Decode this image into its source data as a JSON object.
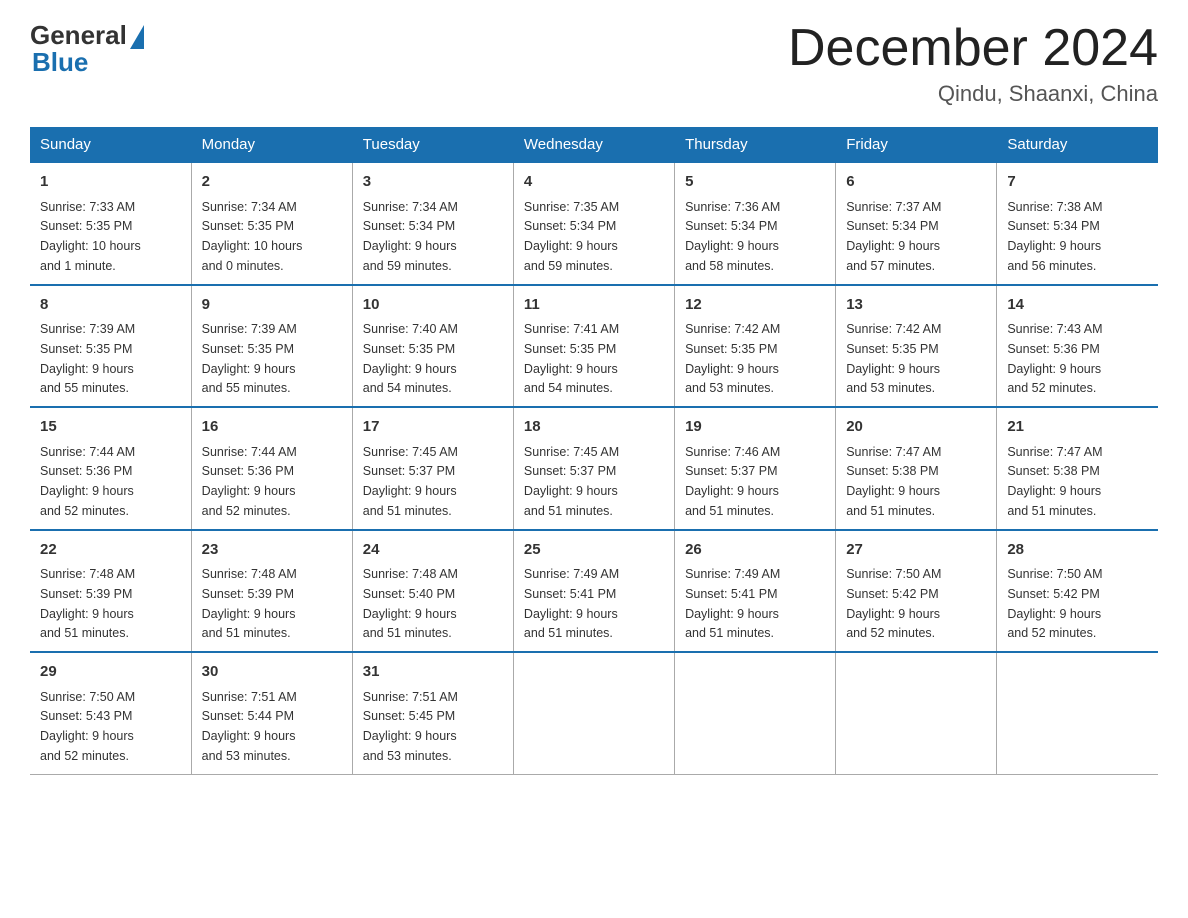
{
  "logo": {
    "general": "General",
    "blue": "Blue"
  },
  "header": {
    "month_year": "December 2024",
    "location": "Qindu, Shaanxi, China"
  },
  "days_of_week": [
    "Sunday",
    "Monday",
    "Tuesday",
    "Wednesday",
    "Thursday",
    "Friday",
    "Saturday"
  ],
  "weeks": [
    [
      {
        "day": "1",
        "info": "Sunrise: 7:33 AM\nSunset: 5:35 PM\nDaylight: 10 hours\nand 1 minute."
      },
      {
        "day": "2",
        "info": "Sunrise: 7:34 AM\nSunset: 5:35 PM\nDaylight: 10 hours\nand 0 minutes."
      },
      {
        "day": "3",
        "info": "Sunrise: 7:34 AM\nSunset: 5:34 PM\nDaylight: 9 hours\nand 59 minutes."
      },
      {
        "day": "4",
        "info": "Sunrise: 7:35 AM\nSunset: 5:34 PM\nDaylight: 9 hours\nand 59 minutes."
      },
      {
        "day": "5",
        "info": "Sunrise: 7:36 AM\nSunset: 5:34 PM\nDaylight: 9 hours\nand 58 minutes."
      },
      {
        "day": "6",
        "info": "Sunrise: 7:37 AM\nSunset: 5:34 PM\nDaylight: 9 hours\nand 57 minutes."
      },
      {
        "day": "7",
        "info": "Sunrise: 7:38 AM\nSunset: 5:34 PM\nDaylight: 9 hours\nand 56 minutes."
      }
    ],
    [
      {
        "day": "8",
        "info": "Sunrise: 7:39 AM\nSunset: 5:35 PM\nDaylight: 9 hours\nand 55 minutes."
      },
      {
        "day": "9",
        "info": "Sunrise: 7:39 AM\nSunset: 5:35 PM\nDaylight: 9 hours\nand 55 minutes."
      },
      {
        "day": "10",
        "info": "Sunrise: 7:40 AM\nSunset: 5:35 PM\nDaylight: 9 hours\nand 54 minutes."
      },
      {
        "day": "11",
        "info": "Sunrise: 7:41 AM\nSunset: 5:35 PM\nDaylight: 9 hours\nand 54 minutes."
      },
      {
        "day": "12",
        "info": "Sunrise: 7:42 AM\nSunset: 5:35 PM\nDaylight: 9 hours\nand 53 minutes."
      },
      {
        "day": "13",
        "info": "Sunrise: 7:42 AM\nSunset: 5:35 PM\nDaylight: 9 hours\nand 53 minutes."
      },
      {
        "day": "14",
        "info": "Sunrise: 7:43 AM\nSunset: 5:36 PM\nDaylight: 9 hours\nand 52 minutes."
      }
    ],
    [
      {
        "day": "15",
        "info": "Sunrise: 7:44 AM\nSunset: 5:36 PM\nDaylight: 9 hours\nand 52 minutes."
      },
      {
        "day": "16",
        "info": "Sunrise: 7:44 AM\nSunset: 5:36 PM\nDaylight: 9 hours\nand 52 minutes."
      },
      {
        "day": "17",
        "info": "Sunrise: 7:45 AM\nSunset: 5:37 PM\nDaylight: 9 hours\nand 51 minutes."
      },
      {
        "day": "18",
        "info": "Sunrise: 7:45 AM\nSunset: 5:37 PM\nDaylight: 9 hours\nand 51 minutes."
      },
      {
        "day": "19",
        "info": "Sunrise: 7:46 AM\nSunset: 5:37 PM\nDaylight: 9 hours\nand 51 minutes."
      },
      {
        "day": "20",
        "info": "Sunrise: 7:47 AM\nSunset: 5:38 PM\nDaylight: 9 hours\nand 51 minutes."
      },
      {
        "day": "21",
        "info": "Sunrise: 7:47 AM\nSunset: 5:38 PM\nDaylight: 9 hours\nand 51 minutes."
      }
    ],
    [
      {
        "day": "22",
        "info": "Sunrise: 7:48 AM\nSunset: 5:39 PM\nDaylight: 9 hours\nand 51 minutes."
      },
      {
        "day": "23",
        "info": "Sunrise: 7:48 AM\nSunset: 5:39 PM\nDaylight: 9 hours\nand 51 minutes."
      },
      {
        "day": "24",
        "info": "Sunrise: 7:48 AM\nSunset: 5:40 PM\nDaylight: 9 hours\nand 51 minutes."
      },
      {
        "day": "25",
        "info": "Sunrise: 7:49 AM\nSunset: 5:41 PM\nDaylight: 9 hours\nand 51 minutes."
      },
      {
        "day": "26",
        "info": "Sunrise: 7:49 AM\nSunset: 5:41 PM\nDaylight: 9 hours\nand 51 minutes."
      },
      {
        "day": "27",
        "info": "Sunrise: 7:50 AM\nSunset: 5:42 PM\nDaylight: 9 hours\nand 52 minutes."
      },
      {
        "day": "28",
        "info": "Sunrise: 7:50 AM\nSunset: 5:42 PM\nDaylight: 9 hours\nand 52 minutes."
      }
    ],
    [
      {
        "day": "29",
        "info": "Sunrise: 7:50 AM\nSunset: 5:43 PM\nDaylight: 9 hours\nand 52 minutes."
      },
      {
        "day": "30",
        "info": "Sunrise: 7:51 AM\nSunset: 5:44 PM\nDaylight: 9 hours\nand 53 minutes."
      },
      {
        "day": "31",
        "info": "Sunrise: 7:51 AM\nSunset: 5:45 PM\nDaylight: 9 hours\nand 53 minutes."
      },
      null,
      null,
      null,
      null
    ]
  ]
}
